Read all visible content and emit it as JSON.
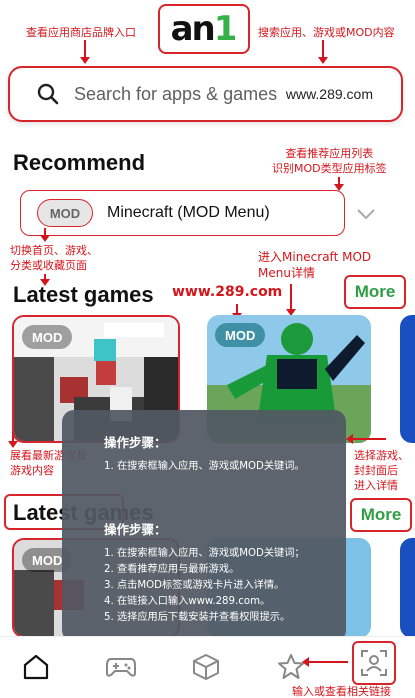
{
  "logo": {
    "part1": "an",
    "part2": "1"
  },
  "search": {
    "placeholder": "Search for apps & games",
    "url_text": "www.289.com"
  },
  "sections": {
    "recommend_title": "Recommend",
    "latest_title": "Latest games",
    "latest_title_repeat": "Latest games",
    "more_label": "More",
    "more_label_2": "More"
  },
  "recommend_item": {
    "badge": "MOD",
    "name": "Minecraft (MOD Menu)"
  },
  "cards": {
    "card1_badge": "MOD",
    "card2_badge": "MOD",
    "card3_badge": "MOD"
  },
  "annotations": {
    "store_entry": "查看应用商店品牌入口",
    "search_hint": "搜索应用、游戏或MOD内容",
    "recommend_hint_line1": "查看推荐应用列表",
    "recommend_hint_line2": "识别MOD类型应用标签",
    "switch_hint_line1": "切换首页、游戏、",
    "switch_hint_line2": "分类或收藏页面",
    "detail_hint_line1": "进入Minecraft MOD",
    "detail_hint_line2": "Menu详情",
    "site_text": "www.289.com",
    "latest_hint_line1": "展看最新游戏及",
    "latest_hint_line2": "游戏内容",
    "select_hint_line1": "选择游戏、",
    "select_hint_line2": "封封面后",
    "select_hint_line3": "进入详情",
    "bottom_hint": "输入或查看相关链接"
  },
  "modal": {
    "title1": "操作步骤：",
    "step_short": "1. 在搜索框输入应用、游戏或MOD关键词。",
    "title2": "操作步骤：",
    "steps": [
      "1. 在搜索框输入应用、游戏或MOD关键词；",
      "2. 查看推荐应用与最新游戏。",
      "3. 点击MOD标签或游戏卡片进入详情。",
      "4. 在链接入口输入www.289.com。",
      "5. 选择应用后下载安装并查看权限提示。"
    ]
  },
  "nav": {
    "items": [
      "home-icon",
      "gamepad-icon",
      "cube-icon",
      "star-icon",
      "scan-user-icon"
    ]
  },
  "colors": {
    "accent_red": "#d4161c",
    "brand_green": "#36b14a",
    "more_green": "#2f9e44",
    "mod_badge_teal": "#3f8fa5"
  }
}
